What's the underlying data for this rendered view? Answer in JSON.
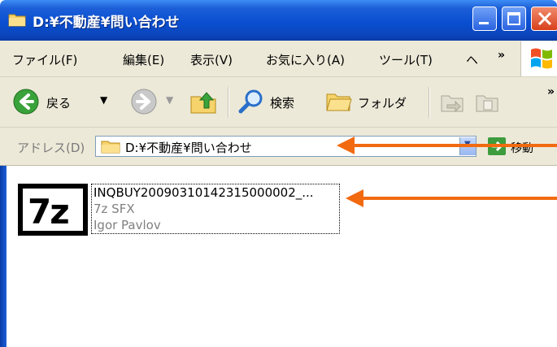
{
  "window": {
    "title": "D:¥不動産¥問い合わせ",
    "colors": {
      "titlebar": "#0a4fd1",
      "accent_arrow": "#f26a10",
      "chrome": "#ece9d8"
    }
  },
  "menu": {
    "items": [
      "ファイル(F)",
      "編集(E)",
      "表示(V)",
      "お気に入り(A)",
      "ツール(T)",
      "ヘ"
    ],
    "more": "»"
  },
  "toolbar": {
    "back_label": "戻る",
    "search_label": "検索",
    "folders_label": "フォルダ",
    "more": "»"
  },
  "address": {
    "label": "アドレス(D)",
    "value": "D:¥不動産¥問い合わせ",
    "go_label": "移動"
  },
  "files": [
    {
      "name": "INQBUY20090310142315000002_...",
      "type": "7z SFX",
      "author": "Igor Pavlov",
      "icon": "7z-archive-icon",
      "icon_text": "7z"
    }
  ]
}
